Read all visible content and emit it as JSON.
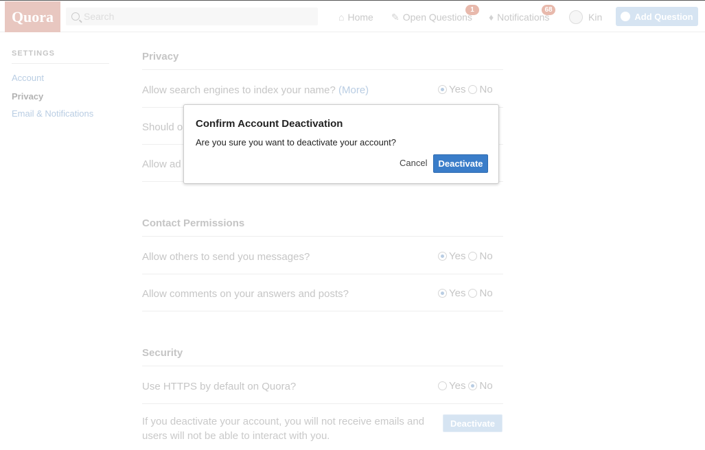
{
  "header": {
    "logo": "Quora",
    "search": {
      "placeholder": "Search"
    },
    "nav": {
      "home": "Home",
      "open_questions": "Open Questions",
      "open_questions_badge": "1",
      "notifications": "Notifications",
      "notifications_badge": "68",
      "user": "Kin",
      "add_question": "Add Question"
    }
  },
  "sidebar": {
    "title": "SETTINGS",
    "items": [
      {
        "label": "Account",
        "active": false
      },
      {
        "label": "Privacy",
        "active": true
      },
      {
        "label": "Email & Notifications",
        "active": false
      }
    ]
  },
  "sections": {
    "privacy": {
      "title": "Privacy",
      "rows": [
        {
          "label": "Allow search engines to index your name?",
          "link": "(More)",
          "value": "Yes"
        },
        {
          "label": "Should o",
          "value": ""
        },
        {
          "label": "Allow ad",
          "value": ""
        }
      ]
    },
    "contact": {
      "title": "Contact Permissions",
      "rows": [
        {
          "label": "Allow others to send you messages?",
          "value": "Yes"
        },
        {
          "label": "Allow comments on your answers and posts?",
          "value": "Yes"
        }
      ]
    },
    "security": {
      "title": "Security",
      "rows": [
        {
          "label": "Use HTTPS by default on Quora?",
          "value": "No"
        }
      ],
      "deactivate_text": "If you deactivate your account, you will not receive emails and users will not be able to interact with you.",
      "deactivate_button": "Deactivate"
    }
  },
  "options": {
    "yes": "Yes",
    "no": "No"
  },
  "dialog": {
    "title": "Confirm Account Deactivation",
    "message": "Are you sure you want to deactivate your account?",
    "cancel": "Cancel",
    "confirm": "Deactivate"
  },
  "colors": {
    "brand": "#b92b27",
    "primary_button": "#3a7dc9",
    "link": "#2b6dad"
  }
}
